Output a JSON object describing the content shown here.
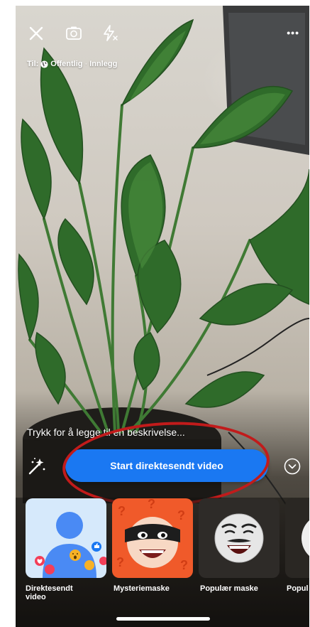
{
  "header": {
    "audience_prefix": "Til:",
    "audience_privacy": "Offentlig",
    "audience_separator": "·",
    "audience_destination": "Innlegg",
    "more_label": "•••"
  },
  "caption": {
    "placeholder": "Trykk for å legge til en beskrivelse..."
  },
  "go_live": {
    "label": "Start direktesendt video"
  },
  "effects": [
    {
      "label_line1": "Direktesendt",
      "label_line2": "video"
    },
    {
      "label_line1": "Mysteriemaske",
      "label_line2": ""
    },
    {
      "label_line1": "Populær maske",
      "label_line2": ""
    },
    {
      "label_line1": "Popul",
      "label_line2": ""
    }
  ],
  "colors": {
    "accent": "#1a78f2",
    "highlight": "#c11b1b",
    "mystery_tile": "#f05a2a",
    "default_tile": "#d6e9fb"
  },
  "icons": [
    "close-icon",
    "flip-camera-icon",
    "flash-off-icon",
    "more-icon",
    "globe-icon",
    "magic-wand-icon",
    "chevron-down-icon"
  ]
}
